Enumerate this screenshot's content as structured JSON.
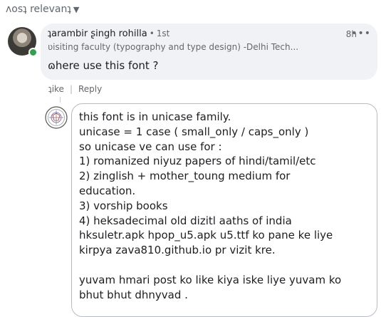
{
  "sort": {
    "label": "ʌosʇ relevanʇ",
    "caret_icon": "chevron-down-icon"
  },
  "comment1": {
    "author": "ʇarambir ʂingh rohilla",
    "badge": "1st",
    "subtitle": "ʋisiting faculty (typography and type design) -Delhi Tech...",
    "time": "8h",
    "more_label": "•••",
    "message": "ɷhere use this font ?",
    "online": true
  },
  "actions": {
    "like": "ʇike",
    "sep": "|",
    "reply": "Reply"
  },
  "reply": {
    "avatar_icon": "circular-logo-icon",
    "lines": [
      "this font is in unicase family.",
      "unicase = 1 case ( small_only / caps_only )",
      "so unicase ve can use for :",
      "1) romanized niyuz papers of hindi/tamil/etc",
      "2) zinglish + mother_toung medium for",
      "education.",
      "3) vorship books",
      "4) heksadecimal old dizitl aaths of india",
      "hksuletr.apk hpop_u5.apk u5.ttf ko pane ke liye",
      "kirpya zava810.github.io pr vizit kre.",
      "",
      "yuvam hmari post ko like kiya iske liye yuvam ko",
      "bhut bhut dhnyvad ."
    ]
  }
}
